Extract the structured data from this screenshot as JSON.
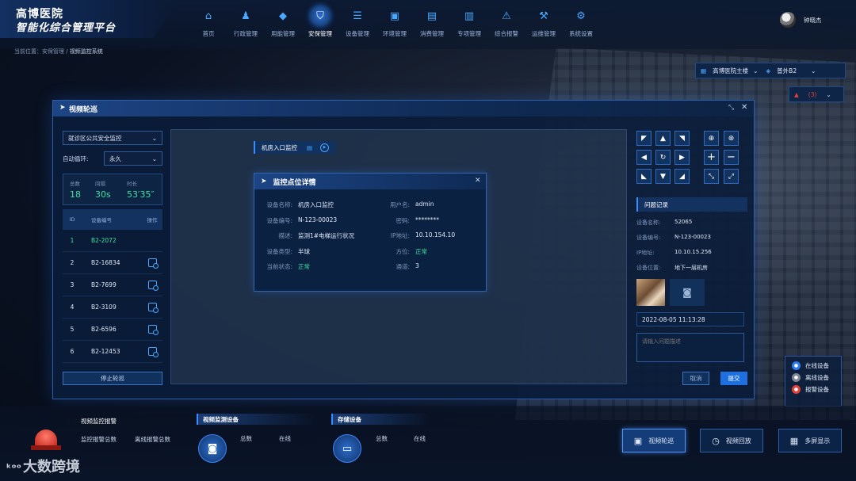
{
  "header": {
    "logo_line1": "高博医院",
    "logo_line2": "智能化综合管理平台",
    "nav": [
      {
        "label": "首页",
        "icon": "home-icon",
        "glyph": "⌂"
      },
      {
        "label": "行政管理",
        "icon": "admin-user-icon",
        "glyph": "♟"
      },
      {
        "label": "用能管理",
        "icon": "energy-drop-icon",
        "glyph": "◆"
      },
      {
        "label": "安保管理",
        "icon": "security-shield-icon",
        "glyph": "⛉",
        "active": true
      },
      {
        "label": "设备管理",
        "icon": "equipment-icon",
        "glyph": "☰"
      },
      {
        "label": "环境管理",
        "icon": "environment-icon",
        "glyph": "▣"
      },
      {
        "label": "消费管理",
        "icon": "consumption-icon",
        "glyph": "▤"
      },
      {
        "label": "专项管理",
        "icon": "special-icon",
        "glyph": "▥"
      },
      {
        "label": "综合报警",
        "icon": "alarm-bell-icon",
        "glyph": "⚠"
      },
      {
        "label": "运维管理",
        "icon": "maintenance-icon",
        "glyph": "⚒"
      },
      {
        "label": "系统设置",
        "icon": "gear-icon",
        "glyph": "⚙"
      }
    ],
    "user_name": "钟晓杰"
  },
  "breadcrumb": {
    "prefix": "当前位置：",
    "path1": "安保管理 / ",
    "current": "视频监控系统"
  },
  "building_select": {
    "building": "高博医院主楼",
    "floor": "普外B2"
  },
  "alarm_badge": {
    "count": "(3)"
  },
  "modal": {
    "title": "视频轮巡",
    "area_select": "就诊区公共安全监控",
    "auto_loop_label": "自动循环:",
    "auto_loop_value": "永久",
    "stats": [
      {
        "label": "总数",
        "value": "18"
      },
      {
        "label": "间隔",
        "value": "30s"
      },
      {
        "label": "时长",
        "value": "53′35″"
      }
    ],
    "table": {
      "headers": [
        "ID",
        "设备编号",
        "操作"
      ],
      "rows": [
        {
          "id": "1",
          "code": "B2-2072"
        },
        {
          "id": "2",
          "code": "B2-16834"
        },
        {
          "id": "3",
          "code": "B2-7699"
        },
        {
          "id": "4",
          "code": "B2-3109"
        },
        {
          "id": "5",
          "code": "B2-6596"
        },
        {
          "id": "6",
          "code": "B2-12453"
        }
      ]
    },
    "stop_button": "停止轮巡",
    "video_tag": "机房入口监控",
    "detail": {
      "title": "监控点位详情",
      "rows": [
        {
          "l1": "设备名称:",
          "v1": "机房入口监控",
          "l2": "用户名:",
          "v2": "admin"
        },
        {
          "l1": "设备编号:",
          "v1": "N-123-00023",
          "l2": "密码:",
          "v2": "********"
        },
        {
          "l1": "描述:",
          "v1": "监测1#电梯运行状况",
          "l2": "IP地址:",
          "v2": "10.10.154.10"
        },
        {
          "l1": "设备类型:",
          "v1": "半球",
          "l2": "方位:",
          "v2": "正常"
        },
        {
          "l1": "当前状态:",
          "v1": "正常",
          "l2": "通道:",
          "v2": "3"
        }
      ]
    },
    "problem": {
      "title": "问题记录",
      "rows": [
        {
          "label": "设备名称:",
          "value": "52065"
        },
        {
          "label": "设备编号:",
          "value": "N-123-00023"
        },
        {
          "label": "IP地址:",
          "value": "10.10.15.256"
        },
        {
          "label": "设备位置:",
          "value": "地下一层机房"
        }
      ],
      "datetime": "2022-08-05 11:13:28",
      "desc_placeholder": "请输入问题描述",
      "cancel": "取消",
      "submit": "提交"
    }
  },
  "bottom": {
    "alarm": {
      "title": "视频监控报警",
      "total_label": "监控报警总数",
      "offline_label": "离线报警总数"
    },
    "monitor": {
      "title": "视频监测设备",
      "total_label": "总数",
      "online_label": "在线"
    },
    "storage": {
      "title": "存储设备",
      "total_label": "总数",
      "online_label": "在线"
    },
    "buttons": {
      "patrol": "视频轮巡",
      "playback": "视频回放",
      "multi": "多屏显示"
    }
  },
  "legend": {
    "online": "在线设备",
    "offline": "离线设备",
    "alarm": "报警设备"
  },
  "watermark": "大数跨境",
  "colors": {
    "accent": "#2a7fff",
    "ok_green": "#3ee0a0",
    "alarm_red": "#e0413a"
  }
}
